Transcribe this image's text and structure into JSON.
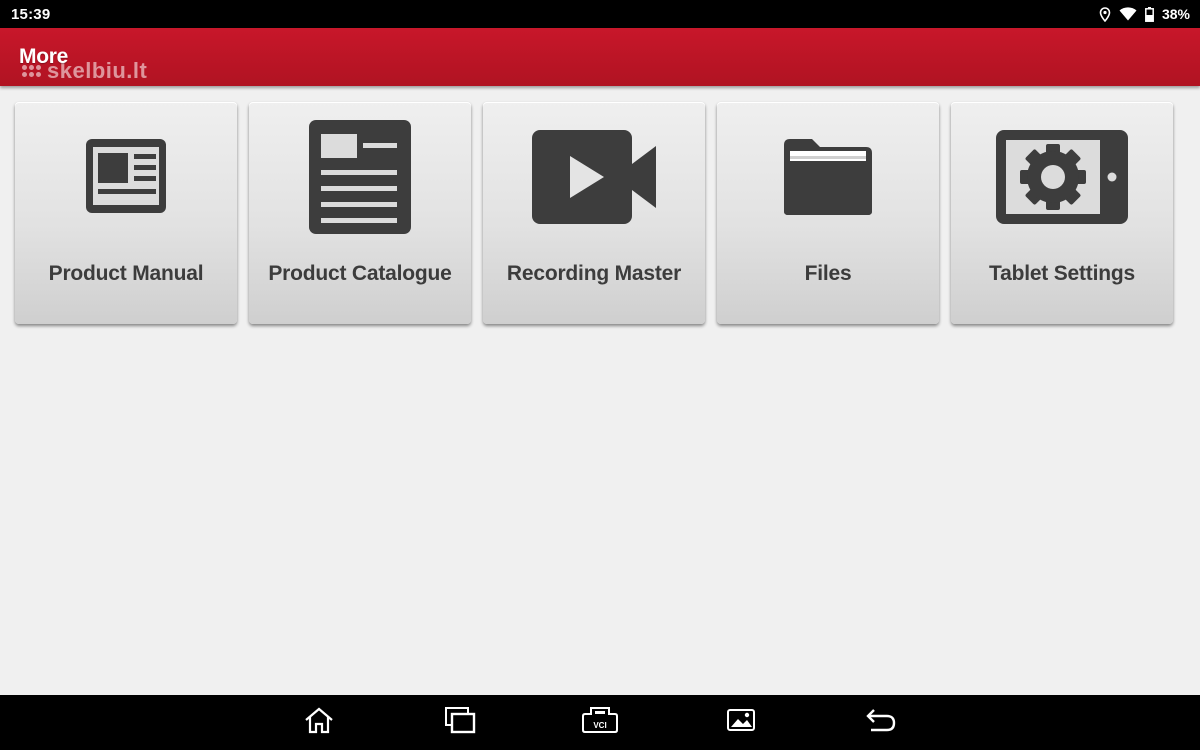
{
  "status_bar": {
    "time": "15:39",
    "battery_percent": "38%",
    "icons": [
      "location-icon",
      "wifi-icon",
      "battery-icon"
    ]
  },
  "header": {
    "title": "More",
    "background_color": "#c8172a"
  },
  "watermark": {
    "text": "skelbiu.lt"
  },
  "tiles": [
    {
      "label": "Product Manual",
      "icon": "product-manual-icon"
    },
    {
      "label": "Product Catalogue",
      "icon": "product-catalogue-icon"
    },
    {
      "label": "Recording Master",
      "icon": "video-camera-icon"
    },
    {
      "label": "Files",
      "icon": "folder-icon"
    },
    {
      "label": "Tablet Settings",
      "icon": "tablet-settings-icon"
    }
  ],
  "nav_bar": {
    "buttons": [
      "home-icon",
      "recent-apps-icon",
      "vci-icon",
      "gallery-icon",
      "back-icon"
    ],
    "vci_label": "VCI"
  },
  "colors": {
    "icon_dark": "#3d3d3d",
    "tile_text": "#3c3c3c",
    "background": "#f0f0f0"
  }
}
